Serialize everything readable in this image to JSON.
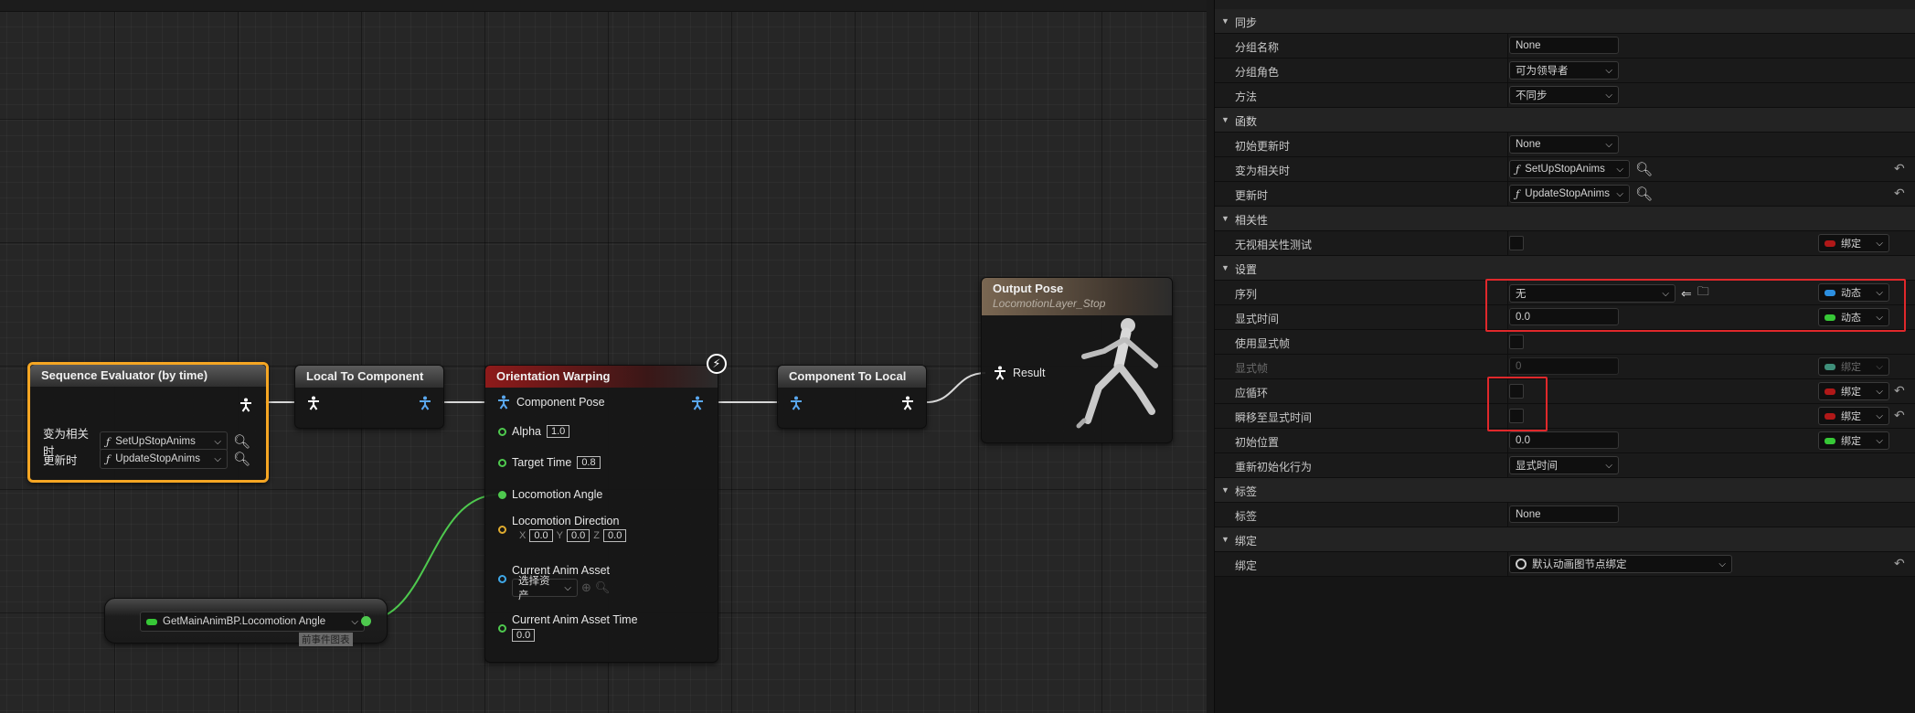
{
  "graph": {
    "nodes": {
      "seq_eval": {
        "title": "Sequence Evaluator (by time)",
        "becomes_relevant_label": "变为相关时",
        "becomes_relevant_fn": "SetUpStopAnims",
        "on_update_label": "更新时",
        "on_update_fn": "UpdateStopAnims"
      },
      "local_to_component": {
        "title": "Local To Component"
      },
      "orientation_warping": {
        "title": "Orientation Warping",
        "component_pose": "Component Pose",
        "alpha_label": "Alpha",
        "alpha_value": "1.0",
        "target_time_label": "Target Time",
        "target_time_value": "0.8",
        "locomotion_angle": "Locomotion Angle",
        "locomotion_direction": "Locomotion Direction",
        "x_label": "X",
        "x_value": "0.0",
        "y_label": "Y",
        "y_value": "0.0",
        "z_label": "Z",
        "z_value": "0.0",
        "current_anim_asset": "Current Anim Asset",
        "select_asset": "选择资产",
        "current_anim_asset_time": "Current Anim Asset Time",
        "current_anim_asset_time_value": "0.0"
      },
      "component_to_local": {
        "title": "Component To Local"
      },
      "output_pose": {
        "title": "Output Pose",
        "subtitle": "LocomotionLayer_Stop",
        "result": "Result"
      },
      "getter": {
        "label": "GetMainAnimBP.Locomotion Angle",
        "tooltip": "前事件图表"
      }
    }
  },
  "details": {
    "categories": [
      {
        "label": "同步",
        "rows": [
          {
            "label": "分组名称",
            "type": "text",
            "value": "None"
          },
          {
            "label": "分组角色",
            "type": "dropdown",
            "value": "可为领导者"
          },
          {
            "label": "方法",
            "type": "dropdown",
            "value": "不同步"
          }
        ]
      },
      {
        "label": "函数",
        "rows": [
          {
            "label": "初始更新时",
            "type": "dropdown",
            "value": "None"
          },
          {
            "label": "变为相关时",
            "type": "fn",
            "value": "SetUpStopAnims"
          },
          {
            "label": "更新时",
            "type": "fn",
            "value": "UpdateStopAnims"
          }
        ]
      },
      {
        "label": "相关性",
        "rows": [
          {
            "label": "无视相关性测试",
            "type": "check",
            "bind": "绑定"
          }
        ]
      },
      {
        "label": "设置",
        "rows": [
          {
            "label": "序列",
            "type": "asset",
            "value": "无",
            "bind": "动态"
          },
          {
            "label": "显式时间",
            "type": "text",
            "value": "0.0",
            "bind": "动态"
          },
          {
            "label": "使用显式帧",
            "type": "check"
          },
          {
            "label": "显式帧",
            "type": "text",
            "value": "0",
            "bind": "绑定"
          },
          {
            "label": "应循环",
            "type": "check",
            "bind": "绑定"
          },
          {
            "label": "瞬移至显式时间",
            "type": "check",
            "bind": "绑定"
          },
          {
            "label": "初始位置",
            "type": "text",
            "value": "0.0",
            "bind": "绑定"
          },
          {
            "label": "重新初始化行为",
            "type": "dropdown",
            "value": "显式时间"
          }
        ]
      },
      {
        "label": "标签",
        "rows": [
          {
            "label": "标签",
            "type": "text",
            "value": "None"
          }
        ]
      },
      {
        "label": "绑定",
        "rows": [
          {
            "label": "绑定",
            "type": "binding",
            "value": "默认动画图节点绑定"
          }
        ]
      }
    ]
  },
  "colors": {
    "selected_outline": "#f5a623",
    "highlight_box": "#e0282b",
    "float_pin": "#4ec94e",
    "bind_red": "#b01818",
    "bind_blue": "#2c8fe0",
    "bind_green": "#37c837",
    "bind_teal": "#3f8f7a"
  }
}
